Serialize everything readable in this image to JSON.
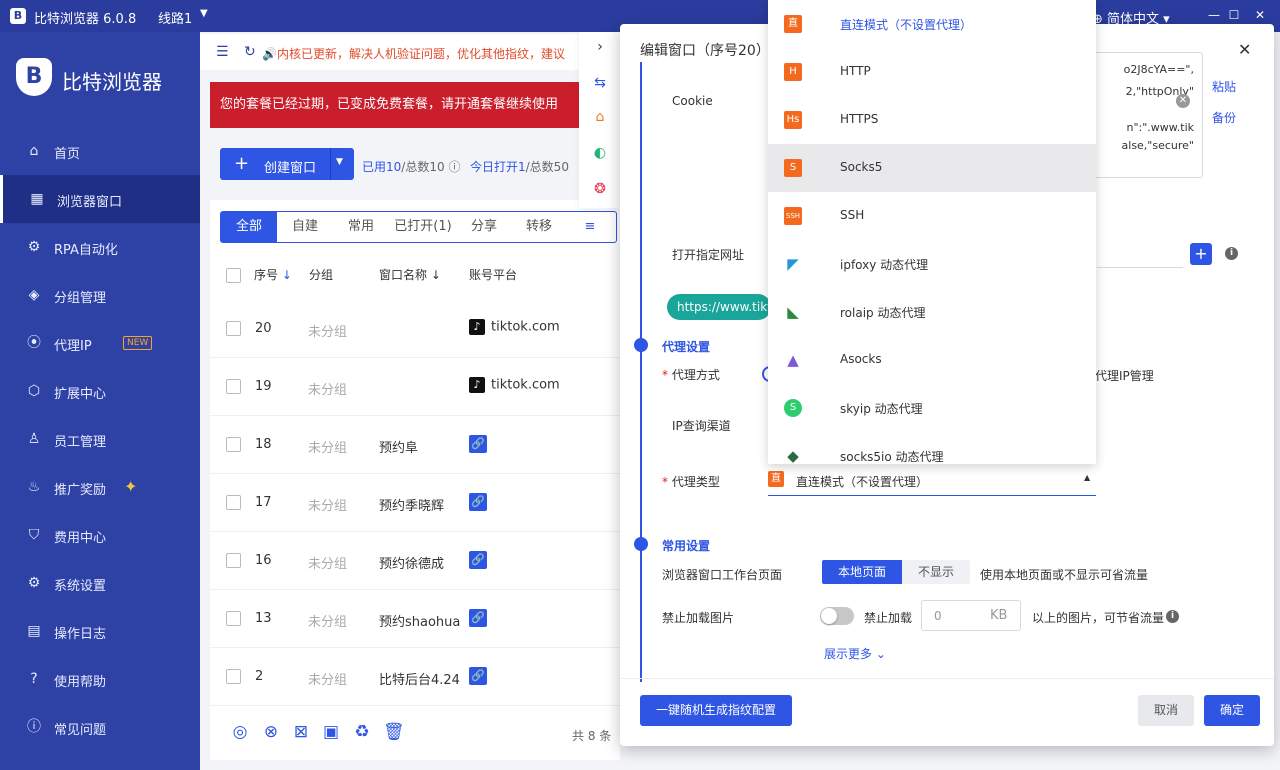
{
  "titlebar": {
    "title": "比特浏览器 6.0.8",
    "line": "线路1",
    "language": "简体中文",
    "logo": "B"
  },
  "sidebar": {
    "brand": "比特浏览器",
    "brand_icon": "B",
    "items": [
      {
        "label": "首页",
        "icon": "home-icon"
      },
      {
        "label": "浏览器窗口",
        "icon": "grid-icon"
      },
      {
        "label": "RPA自动化",
        "icon": "rpa-icon"
      },
      {
        "label": "分组管理",
        "icon": "cube-icon"
      },
      {
        "label": "代理IP",
        "icon": "location-pin-icon",
        "badge": "NEW"
      },
      {
        "label": "扩展中心",
        "icon": "box-icon"
      },
      {
        "label": "员工管理",
        "icon": "users-icon"
      },
      {
        "label": "推广奖励",
        "icon": "gift-icon"
      },
      {
        "label": "费用中心",
        "icon": "shield-yen-icon"
      },
      {
        "label": "系统设置",
        "icon": "gear-icon"
      },
      {
        "label": "操作日志",
        "icon": "log-icon"
      },
      {
        "label": "使用帮助",
        "icon": "help-icon"
      },
      {
        "label": "常见问题",
        "icon": "info-icon"
      }
    ]
  },
  "notice": "内核已更新，解决人机验证问题，优化其他指纹，建议",
  "alert": "您的套餐已经过期，已变成免费套餐，请开通套餐继续使用",
  "toolbar": {
    "create_label": "创建窗口",
    "used_label": "已用10",
    "used_total": "/总数10",
    "today_label": "今日打开1",
    "today_total": "/总数50"
  },
  "tabs": [
    "全部",
    "自建",
    "常用",
    "已打开(1)",
    "分享",
    "转移"
  ],
  "table": {
    "headers": [
      "序号",
      "分组",
      "窗口名称",
      "账号平台"
    ],
    "rows": [
      {
        "num": "20",
        "group": "未分组",
        "name": "",
        "platform": "tiktok.com"
      },
      {
        "num": "19",
        "group": "未分组",
        "name": "",
        "platform": "tiktok.com"
      },
      {
        "num": "18",
        "group": "未分组",
        "name": "预约阜",
        "platform": ""
      },
      {
        "num": "17",
        "group": "未分组",
        "name": "预约季晓辉",
        "platform": ""
      },
      {
        "num": "16",
        "group": "未分组",
        "name": "预约徐德成",
        "platform": ""
      },
      {
        "num": "13",
        "group": "未分组",
        "name": "预约shaohua",
        "platform": ""
      },
      {
        "num": "2",
        "group": "未分组",
        "name": "比特后台4.24",
        "platform": ""
      }
    ],
    "total": "共 8 条"
  },
  "modal": {
    "title": "编辑窗口（序号20）",
    "cookie_label": "Cookie",
    "cookie_lines": [
      "o2J8cYA==\",",
      "2,\"httpOnly\"",
      "n\":\".www.tik",
      "alse,\"secure\""
    ],
    "paste": "粘贴",
    "backup": "备份",
    "open_url_label": "打开指定网址",
    "url_chip": "https://www.tikt",
    "proxy_section": "代理设置",
    "proxy_mode_label": "代理方式",
    "ip_mgmt_text": "代理IP管理",
    "ip_query_label": "IP查询渠道",
    "proxy_type_label": "代理类型",
    "proxy_type_value": "直连模式（不设置代理）",
    "proxy_type_icon": "直",
    "common_section": "常用设置",
    "workbench_label": "浏览器窗口工作台页面",
    "workbench_on": "本地页面",
    "workbench_off": "不显示",
    "workbench_hint": "使用本地页面或不显示可省流量",
    "block_images_label": "禁止加载图片",
    "block_toggle_label": "禁止加载",
    "kb_value": "0",
    "kb_unit": "KB",
    "kb_hint": "以上的图片，可节省流量",
    "show_more": "展示更多",
    "gen_button": "一键随机生成指纹配置",
    "cancel": "取消",
    "ok": "确定"
  },
  "dropdown": {
    "selected": "直连模式（不设置代理）",
    "hovered": "Socks5",
    "options": [
      {
        "label": "直连模式（不设置代理）",
        "icon": "直",
        "icon_name": "direct-icon"
      },
      {
        "label": "HTTP",
        "icon": "H",
        "icon_name": "http-icon"
      },
      {
        "label": "HTTPS",
        "icon": "Hs",
        "icon_name": "https-icon"
      },
      {
        "label": "Socks5",
        "icon": "S",
        "icon_name": "socks5-icon"
      },
      {
        "label": "SSH",
        "icon": "SSH",
        "icon_name": "ssh-icon"
      },
      {
        "label": "ipfoxy 动态代理",
        "icon": "◤",
        "icon_name": "ipfoxy-icon"
      },
      {
        "label": "rolaip 动态代理",
        "icon": "◣",
        "icon_name": "rolaip-icon"
      },
      {
        "label": "Asocks",
        "icon": "▲",
        "icon_name": "asocks-icon"
      },
      {
        "label": "skyip 动态代理",
        "icon": "S",
        "icon_name": "skyip-icon"
      },
      {
        "label": "socks5io 动态代理",
        "icon": "◆",
        "icon_name": "socks5io-icon"
      }
    ]
  },
  "colors": {
    "primary": "#2f55e4",
    "sidebar": "#2e42a5",
    "alert": "#cb1e2c",
    "orange": "#f36a1f",
    "teal": "#1aa59a"
  }
}
